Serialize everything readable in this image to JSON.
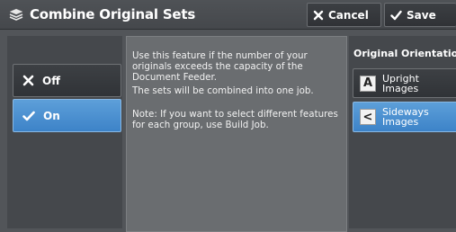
{
  "header": {
    "title": "Combine Original Sets",
    "cancel_label": "Cancel",
    "save_label": "Save"
  },
  "options": {
    "off_label": "Off",
    "on_label": "On",
    "selected": "On"
  },
  "message": {
    "line1": "Use this feature if the number of your originals exceeds the capacity of the Document Feeder.",
    "line2": "The sets will be combined into one job.",
    "line3": "Note: If you want to select different features for each group, use Build Job."
  },
  "orientation": {
    "label": "Original Orientation",
    "upright_glyph": "A",
    "upright_label": "Upright Images",
    "sideways_glyph": "<",
    "sideways_label": "Sideways Images",
    "selected": "Sideways Images"
  },
  "colors": {
    "selected_blue": "#4a8fd0",
    "panel_dark": "#45484c",
    "message_bg": "#6a6d70"
  }
}
